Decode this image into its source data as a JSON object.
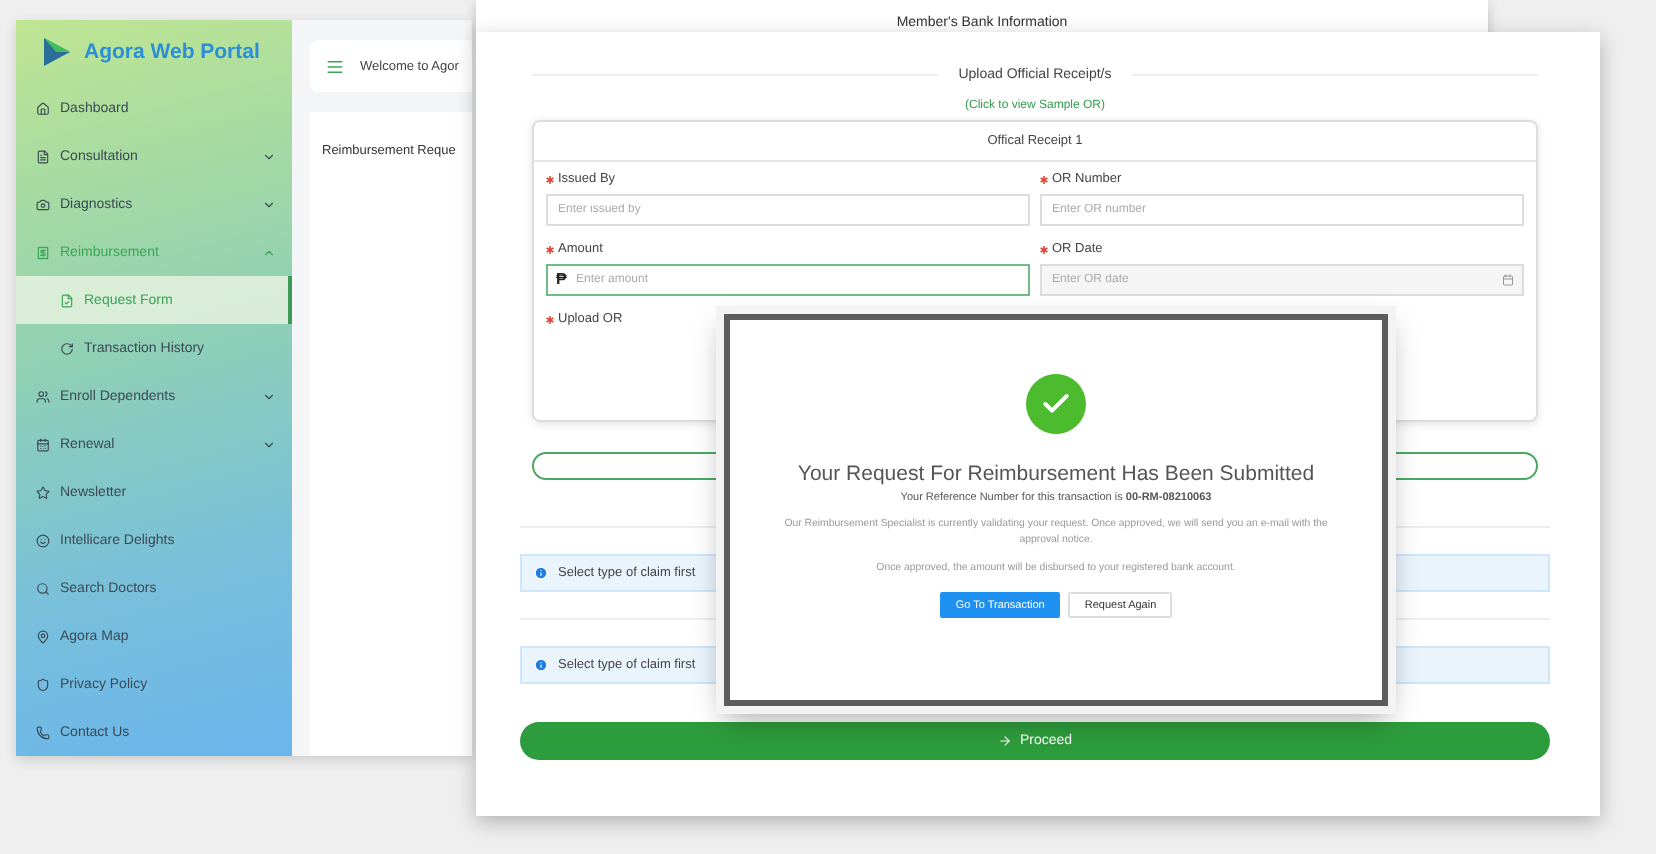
{
  "portal": {
    "logo_text": "Agora Web Portal",
    "header_text": "Welcome to Agor",
    "content_title": "Reimbursement Reque",
    "menu": [
      {
        "label": "Dashboard",
        "selected": false
      },
      {
        "label": "Consultation",
        "selected": false,
        "expanded": false
      },
      {
        "label": "Diagnostics",
        "selected": false,
        "expanded": false
      },
      {
        "label": "Reimbursement",
        "selected": true,
        "expanded": true,
        "children": [
          {
            "label": "Request Form",
            "selected": true
          },
          {
            "label": "Transaction History",
            "selected": false
          }
        ]
      },
      {
        "label": "Enroll Dependents",
        "selected": false,
        "expanded": false
      },
      {
        "label": "Renewal",
        "selected": false,
        "expanded": false
      },
      {
        "label": "Newsletter",
        "selected": false
      },
      {
        "label": "Intellicare Delights",
        "selected": false
      },
      {
        "label": "Search Doctors",
        "selected": false
      },
      {
        "label": "Agora Map",
        "selected": false
      },
      {
        "label": "Privacy Policy",
        "selected": false
      },
      {
        "label": "Contact Us",
        "selected": false
      }
    ]
  },
  "bank_section": {
    "title": "Member's Bank Information"
  },
  "form": {
    "title": "Upload Official Receipt/s",
    "sample_link": "(Click to view Sample OR)",
    "receipt": {
      "title": "Offical Receipt 1",
      "fields": [
        {
          "kind": "text",
          "label": "Issued By",
          "required": true,
          "placeholder": "Enter issued by",
          "focused": false
        },
        {
          "kind": "text",
          "label": "OR Number",
          "required": true,
          "placeholder": "Enter OR number",
          "focused": false
        },
        {
          "kind": "amount",
          "label": "Amount",
          "required": true,
          "prefix": "₱",
          "placeholder": "Enter amount",
          "focused": true
        },
        {
          "kind": "date",
          "label": "OR Date",
          "required": true,
          "placeholder": "Enter OR date",
          "focused": false
        },
        {
          "kind": "upload",
          "label": "Upload OR",
          "required": true
        }
      ]
    },
    "notices": [
      "Select type of claim first",
      "Select type of claim first"
    ],
    "proceed": "Proceed"
  },
  "modal": {
    "title": "Your Request For Reimbursement Has Been Submitted",
    "reference": "Your Reference Number for this transaction is **00-RM-08210063**",
    "message": "Our Reimbursement Specialist is currently validating your request. Once approved, we will send you an e-mail with the approval notice.",
    "note": "Once approved, the amount will be disbursed to your registered bank account.",
    "buttons": [
      {
        "kind": "primary",
        "label": "Go To Transaction"
      },
      {
        "kind": "secondary",
        "label": "Request Again"
      }
    ]
  }
}
